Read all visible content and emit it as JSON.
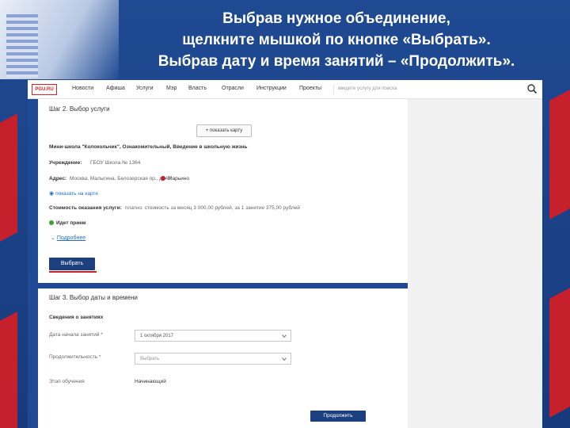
{
  "slide": {
    "title_lines": [
      "Выбрав нужное объединение,",
      "щелкните мышкой по кнопке «Выбрать».",
      "Выбрав дату и время занятий – «Продолжить»."
    ]
  },
  "navbar": {
    "logo": "PGU.RU",
    "items": [
      "Новости",
      "Афиша",
      "Услуги",
      "Мэр",
      "Власть",
      "Отрасли",
      "Инструкции",
      "Проекты"
    ],
    "search_placeholder": "введите услугу для поиска"
  },
  "step2": {
    "title": "Шаг 2. Выбор услуги",
    "map_button": "+ показать карту",
    "service_name": "Мини-школа \"Колокольчик\", Ознакомительный, Введение в школьную жизнь",
    "institution_label": "Учреждение:",
    "institution_value": "ГБОУ Школа № 1364",
    "address_label": "Адрес:",
    "address_value": "Москва, Малыгина, Белозерская пр., д. 47",
    "metro": "Марьино",
    "show_map_link": "показать на карте",
    "cost_label": "Стоимость оказания услуги:",
    "cost_value": "платно: стоимость за месяц 3 000,00 рублей, за 1 занятие 375,00 рублей",
    "status": "Идет прием",
    "more_link": "Подробнее",
    "select_button": "Выбрать"
  },
  "step3": {
    "title": "Шаг 3. Выбор даты и времени",
    "section_title": "Сведения о занятиях",
    "start_date_label": "Дата начала занятий *",
    "start_date_value": "1 октября 2017",
    "duration_label": "Продолжительность *",
    "duration_placeholder": "Выбрать",
    "stage_label": "Этап обучения",
    "stage_value": "Начинающий",
    "continue_button": "Продолжить"
  },
  "colors": {
    "brand_blue": "#1f4a93",
    "button_blue": "#1c3f7d",
    "accent_red": "#c7202d",
    "status_green": "#3aa335"
  }
}
